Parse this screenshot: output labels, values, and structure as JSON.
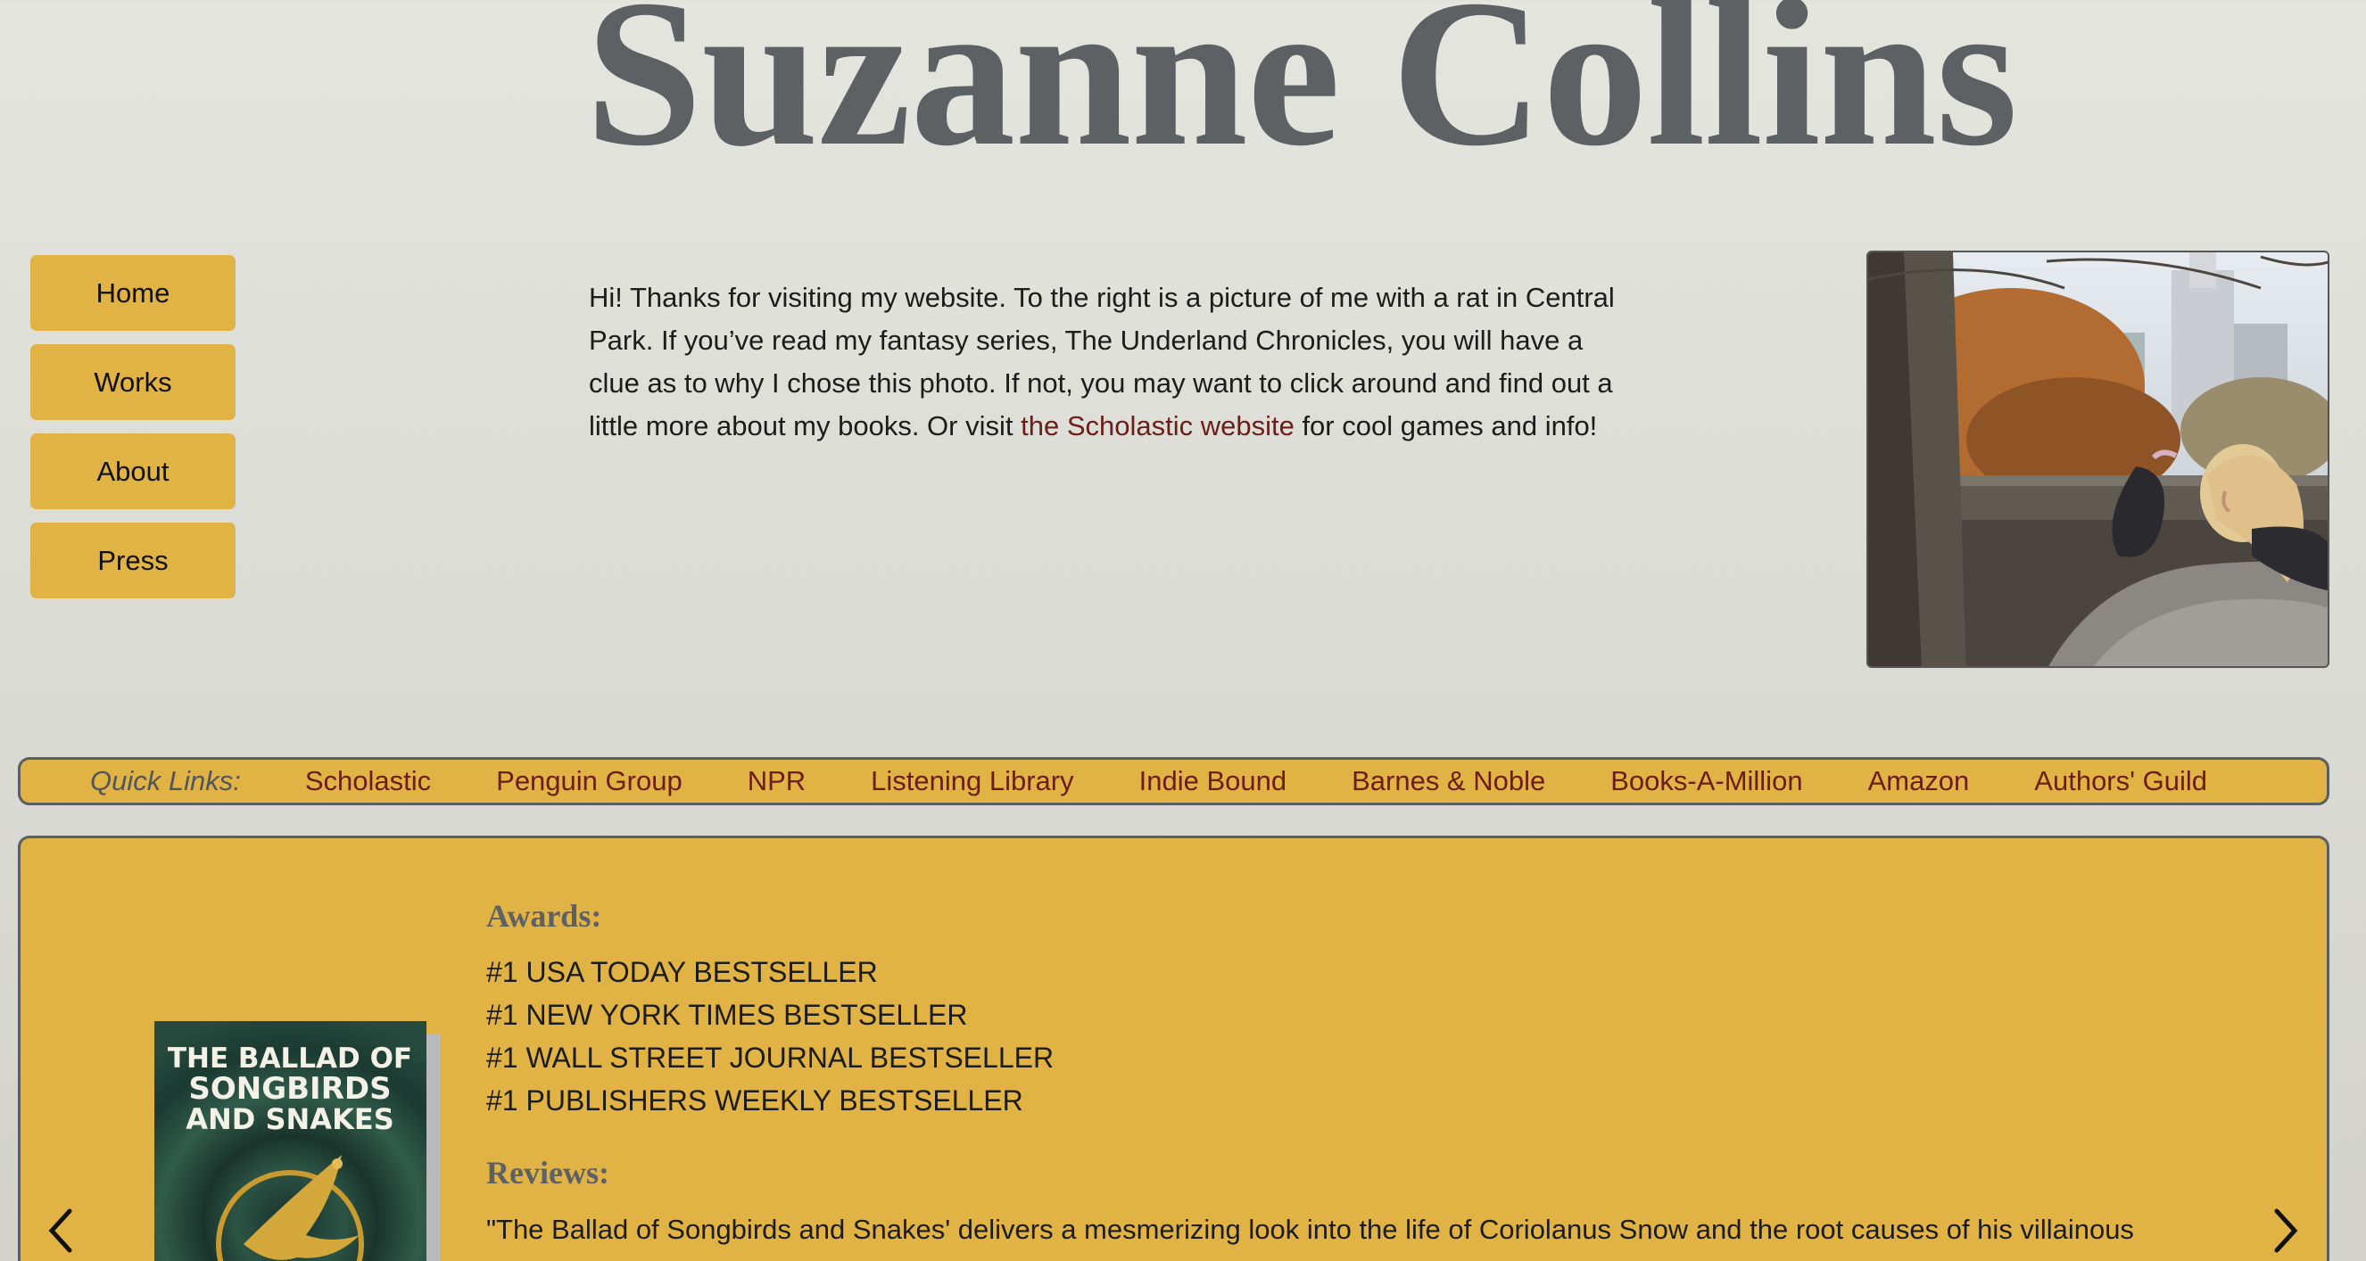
{
  "header": {
    "title": "Suzanne Collins"
  },
  "nav": {
    "items": [
      {
        "label": "Home"
      },
      {
        "label": "Works"
      },
      {
        "label": "About"
      },
      {
        "label": "Press"
      }
    ]
  },
  "intro": {
    "text_before": "Hi! Thanks for visiting my website. To the right is a picture of me with a rat in Central Park. If you’ve read my fantasy series, The Underland Chronicles, you will have a clue as to why I chose this photo. If not, you may want to click around and find out a little more about my books. Or visit ",
    "link_text": "the Scholastic website",
    "text_after": " for cool games and info!"
  },
  "quick_links": {
    "label": "Quick Links:",
    "items": [
      "Scholastic",
      "Penguin Group",
      "NPR",
      "Listening Library",
      "Indie Bound",
      "Barnes & Noble",
      "Books-A-Million",
      "Amazon",
      "Authors' Guild"
    ]
  },
  "featured": {
    "book_title_lines": [
      "THE BALLAD OF",
      "SONGBIRDS",
      "AND SNAKES"
    ],
    "awards_heading": "Awards:",
    "awards": [
      "#1 USA TODAY BESTSELLER",
      "#1 NEW YORK TIMES BESTSELLER",
      "#1 WALL STREET JOURNAL BESTSELLER",
      "#1 PUBLISHERS WEEKLY BESTSELLER"
    ],
    "reviews_heading": "Reviews:",
    "review_text": "\"The Ballad of Songbirds and Snakes' delivers a mesmerizing look into the life of Coriolanus Snow and the root causes of his villainous"
  },
  "colors": {
    "accent": "#e1b345",
    "link": "#6b1d16",
    "title": "#5d6164",
    "border": "#5a5e60"
  },
  "icons": {
    "prev": "chevron-left-icon",
    "next": "chevron-right-icon"
  }
}
